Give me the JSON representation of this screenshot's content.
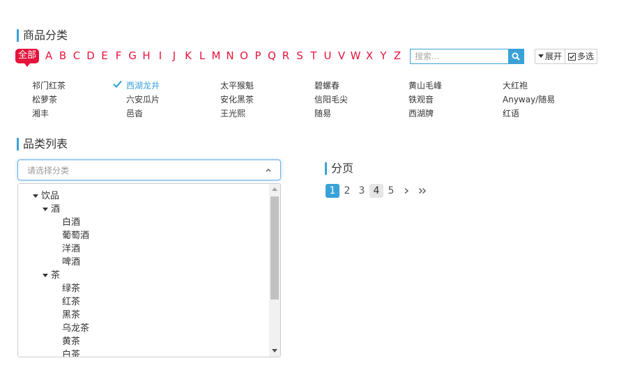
{
  "category_section": {
    "title": "商品分类"
  },
  "letter_filter": {
    "all_label": "全部",
    "letters": [
      "A",
      "B",
      "C",
      "D",
      "E",
      "F",
      "G",
      "H",
      "I",
      "J",
      "K",
      "L",
      "M",
      "N",
      "O",
      "P",
      "Q",
      "R",
      "S",
      "T",
      "U",
      "V",
      "W",
      "X",
      "Y",
      "Z"
    ]
  },
  "search": {
    "placeholder": "搜索..."
  },
  "toolbar": {
    "expand_label": "展开",
    "multi_label": "多选"
  },
  "categories": [
    [
      "祁门红茶",
      "西湖龙井",
      "太平猴魁",
      "碧螺春",
      "黄山毛峰",
      "大红袍"
    ],
    [
      "松萝茶",
      "六安瓜片",
      "安化黑茶",
      "信阳毛尖",
      "铁观音",
      "Anyway/随易"
    ],
    [
      "湘丰",
      "邑沓",
      "王光熙",
      "随易",
      "西湖牌",
      "红语"
    ]
  ],
  "selected_category": "西湖龙井",
  "list_section": {
    "title": "品类列表"
  },
  "select": {
    "placeholder": "请选择分类"
  },
  "tree": {
    "root": "饮品",
    "groups": [
      {
        "label": "酒",
        "items": [
          "白酒",
          "葡萄酒",
          "洋酒",
          "啤酒"
        ]
      },
      {
        "label": "茶",
        "items": [
          "绿茶",
          "红茶",
          "黑茶",
          "乌龙茶",
          "黄茶",
          "白茶"
        ]
      }
    ]
  },
  "pagination_section": {
    "title": "分页"
  },
  "pagination": {
    "pages": [
      "1",
      "2",
      "3",
      "4",
      "5"
    ],
    "active": "1",
    "hover": "4"
  },
  "colors": {
    "accent": "#3aa2d8",
    "letter": "#e4143c"
  }
}
